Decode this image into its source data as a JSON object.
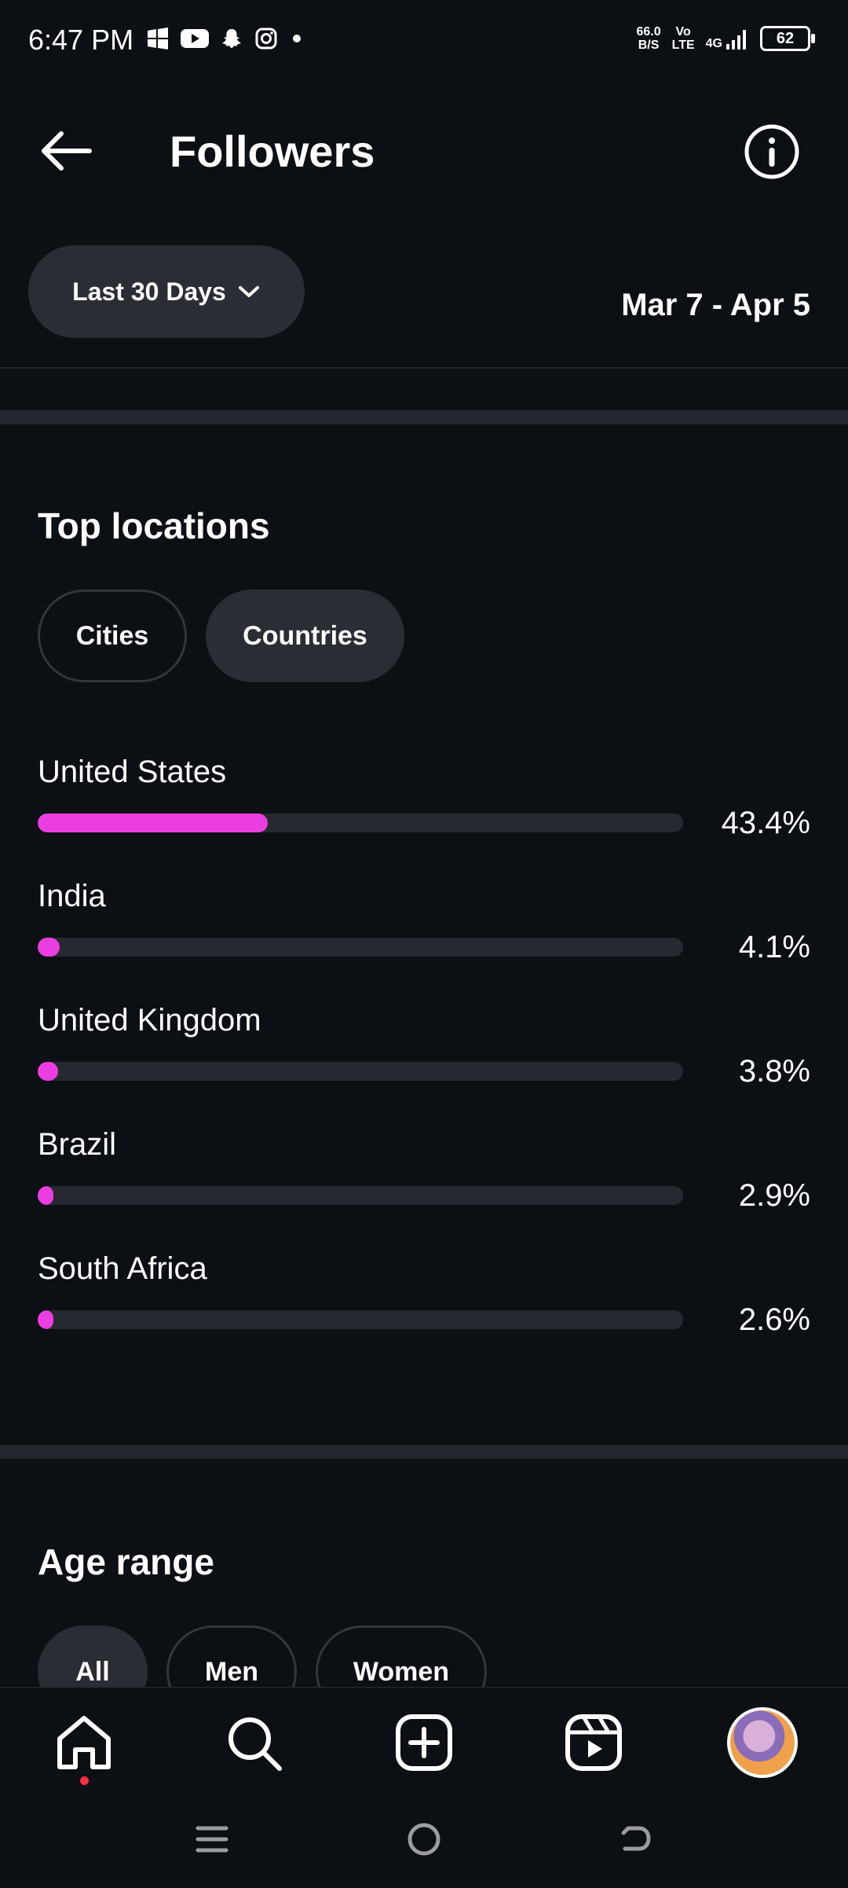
{
  "status_bar": {
    "time": "6:47 PM",
    "net_speed_value": "66.0",
    "net_speed_unit": "B/S",
    "volte_top": "Vo",
    "volte_bottom": "LTE",
    "network": "4G",
    "battery": "62"
  },
  "header": {
    "title": "Followers"
  },
  "filter": {
    "range_label": "Last 30 Days",
    "date_range": "Mar 7 - Apr 5"
  },
  "top_locations": {
    "title": "Top locations",
    "tabs": [
      {
        "label": "Cities",
        "selected": false
      },
      {
        "label": "Countries",
        "selected": true
      }
    ],
    "items": [
      {
        "name": "United States",
        "percent_label": "43.4%",
        "value": 43.4
      },
      {
        "name": "India",
        "percent_label": "4.1%",
        "value": 4.1
      },
      {
        "name": "United Kingdom",
        "percent_label": "3.8%",
        "value": 3.8
      },
      {
        "name": "Brazil",
        "percent_label": "2.9%",
        "value": 2.9
      },
      {
        "name": "South Africa",
        "percent_label": "2.6%",
        "value": 2.6
      }
    ],
    "bar_color": "#ec3ee0"
  },
  "age_range": {
    "title": "Age range",
    "tabs": [
      {
        "label": "All",
        "selected": true
      },
      {
        "label": "Men",
        "selected": false
      },
      {
        "label": "Women",
        "selected": false
      }
    ]
  },
  "bottom_nav": {
    "items": [
      "home-icon",
      "search-icon",
      "create-icon",
      "reels-icon",
      "profile-avatar"
    ],
    "notification_color": "#ff3040"
  },
  "system_nav": [
    "menu-icon",
    "home-circle-icon",
    "back-icon"
  ]
}
